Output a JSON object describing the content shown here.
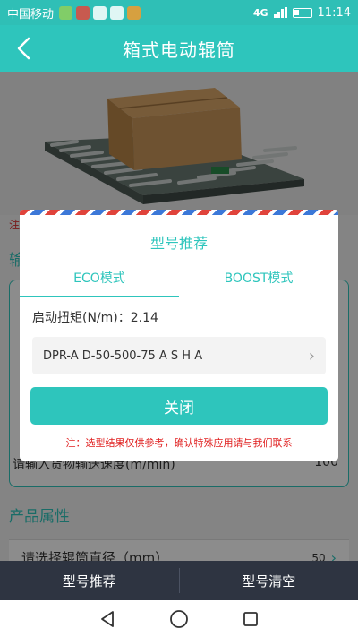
{
  "status_bar": {
    "carrier": "中国移动",
    "network": "4G",
    "time": "11:14"
  },
  "header": {
    "title": "箱式电动辊筒"
  },
  "background_page": {
    "note": "注",
    "section_transport": "输",
    "speed_label": "请输入货物输送速度(m/min)",
    "speed_value": "100",
    "section_product": "产品属性",
    "diameter_label": "请选择辊筒直径（mm）",
    "diameter_value": "50"
  },
  "modal": {
    "title": "型号推荐",
    "tabs": [
      {
        "label": "ECO模式",
        "active": true
      },
      {
        "label": "BOOST模式",
        "active": false
      }
    ],
    "torque_label": "启动扭矩(N/m)：",
    "torque_value": "2.14",
    "model_number": "DPR-A D-50-500-75 A S H A",
    "close_label": "关闭",
    "disclaimer": "注：选型结果仅供参考，确认特殊应用请与我们联系"
  },
  "bottom_bar": {
    "recommend_label": "型号推荐",
    "clear_label": "型号清空"
  },
  "colors": {
    "accent": "#2ec5bc",
    "bottom_bar": "#2e3441",
    "warning": "#e02020"
  }
}
